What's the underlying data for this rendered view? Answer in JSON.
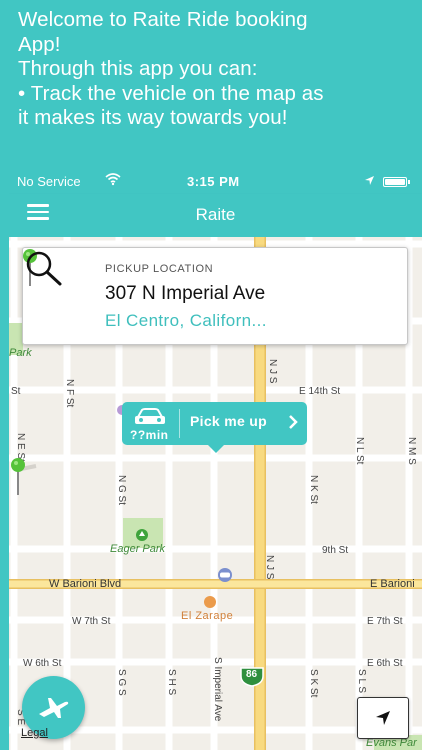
{
  "promo": {
    "lines": [
      "Welcome to Raite Ride booking",
      "App!",
      "Through this app you can:",
      "• Track the vehicle on the map as",
      "it makes its way towards you!"
    ]
  },
  "status_bar": {
    "carrier": "No Service",
    "time": "3:15 PM"
  },
  "nav": {
    "title": "Raite",
    "menu_icon": "hamburger-menu-icon"
  },
  "pickup_card": {
    "title": "PICKUP LOCATION",
    "address": "307 N Imperial Ave",
    "city": "El Centro,  Californ...",
    "pin_icon": "green-pin-icon",
    "search_icon": "search-icon"
  },
  "callout": {
    "eta": "??min",
    "action": "Pick me up",
    "car_icon": "car-icon",
    "chevron_icon": "chevron-right-icon"
  },
  "map": {
    "streets": {
      "e14th": "E 14th St",
      "st_left": "St",
      "nf": "N F St",
      "nls": "N L St",
      "nms": "N M S",
      "ne": "N E St",
      "ngs": "N G St",
      "nks": "N K St",
      "njs": "N J S",
      "njs2": "N J S",
      "ninth": "9th St",
      "wbarioni": "W Barioni Blvd",
      "ebarioni": "E Barioni",
      "w7th": "W 7th St",
      "e7th": "E 7th St",
      "w6th": "W 6th St",
      "e6th": "E 6th St",
      "sgs": "S G S",
      "shs": "S H S",
      "sks": "S K St",
      "sls": "S L S",
      "simperial": "S Imperial Ave",
      "se": "S E"
    },
    "parks": {
      "park_left": "Park",
      "eager": "Eager Park",
      "evans": "Evans Par"
    },
    "poi": {
      "el_zarape": "El Zarape"
    },
    "route_shield": "86",
    "legal": "Legal"
  },
  "buttons": {
    "plane_icon": "airplane-icon",
    "locate_icon": "location-arrow-icon"
  },
  "colors": {
    "accent": "#41c6c3",
    "city_text": "#3fbfbd",
    "map_bg": "#f2efe9",
    "highway": "#f6d374"
  }
}
